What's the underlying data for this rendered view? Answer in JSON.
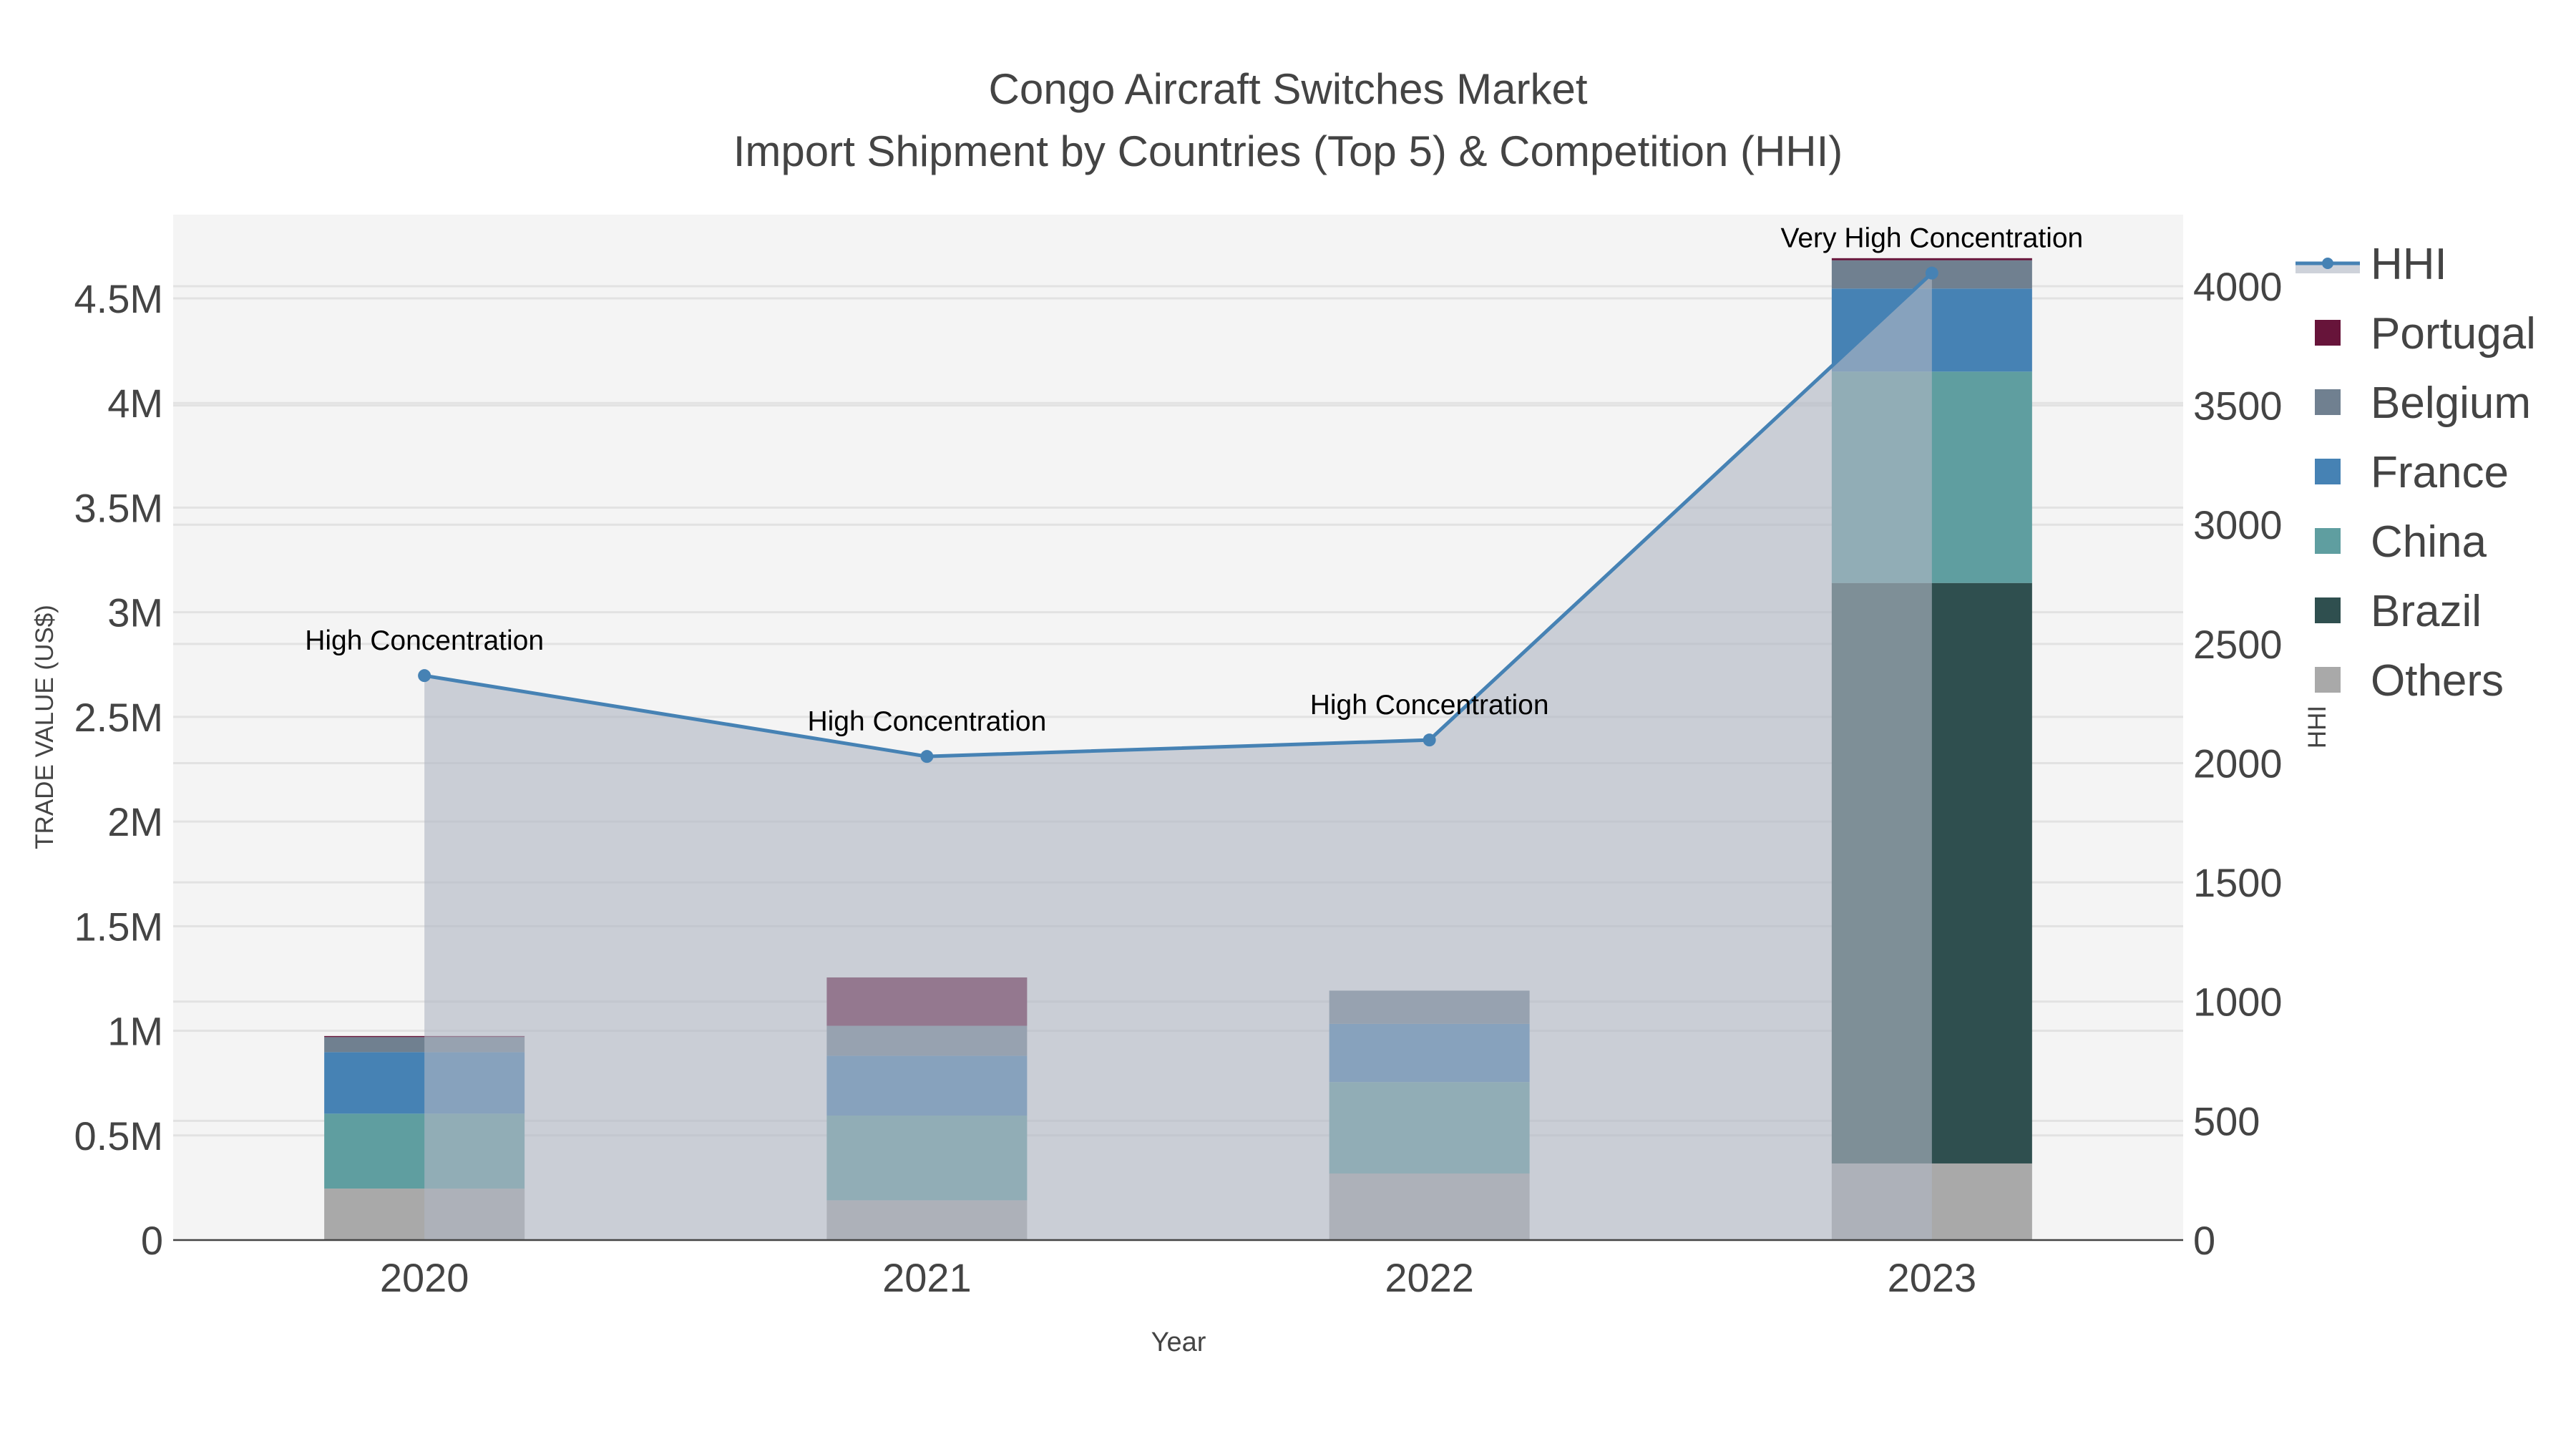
{
  "chart_data": {
    "type": "bar",
    "title": "Congo Aircraft Switches Market",
    "subtitle": "Import Shipment by Countries (Top 5) & Competition (HHI)",
    "xlabel": "Year",
    "ylabel": "TRADE VALUE (US$)",
    "y2label": "HHI",
    "categories": [
      "2020",
      "2021",
      "2022",
      "2023"
    ],
    "ylim": [
      0,
      4.9
    ],
    "y_unit": "M",
    "yticks": [
      0,
      0.5,
      1,
      1.5,
      2,
      2.5,
      3,
      3.5,
      4,
      4.5
    ],
    "ytick_labels": [
      "0",
      "0.5M",
      "1M",
      "1.5M",
      "2M",
      "2.5M",
      "3M",
      "3.5M",
      "4M",
      "4.5M"
    ],
    "y2lim": [
      0,
      4300
    ],
    "y2ticks": [
      0,
      500,
      1000,
      1500,
      2000,
      2500,
      3000,
      3500,
      4000
    ],
    "y2tick_labels": [
      "0",
      "500",
      "1000",
      "1500",
      "2000",
      "2500",
      "3000",
      "3500",
      "4000"
    ],
    "stack_order": [
      "Others",
      "Brazil",
      "China",
      "France",
      "Belgium",
      "Portugal"
    ],
    "series": [
      {
        "name": "Portugal",
        "color": "#67143a",
        "values": [
          0.005,
          0.231,
          0,
          0.01
        ]
      },
      {
        "name": "Belgium",
        "color": "#708090",
        "values": [
          0.072,
          0.143,
          0.159,
          0.135
        ]
      },
      {
        "name": "France",
        "color": "#4682b4",
        "values": [
          0.294,
          0.286,
          0.278,
          0.397
        ]
      },
      {
        "name": "China",
        "color": "#5f9ea0",
        "values": [
          0.358,
          0.405,
          0.437,
          1.01
        ]
      },
      {
        "name": "Brazil",
        "color": "#2f4f4f",
        "values": [
          0,
          0,
          0,
          2.774
        ]
      },
      {
        "name": "Others",
        "color": "#a9a9a9",
        "values": [
          0.246,
          0.19,
          0.318,
          0.366
        ]
      }
    ],
    "line": {
      "name": "HHI",
      "color": "#4682b4",
      "values": [
        2367,
        2028,
        2097,
        4055
      ],
      "annotations": [
        "High Concentration",
        "High Concentration",
        "High Concentration",
        "Very High Concentration"
      ]
    },
    "legend": [
      "HHI",
      "Portugal",
      "Belgium",
      "France",
      "China",
      "Brazil",
      "Others"
    ],
    "legend_position": "right",
    "grid": true
  }
}
